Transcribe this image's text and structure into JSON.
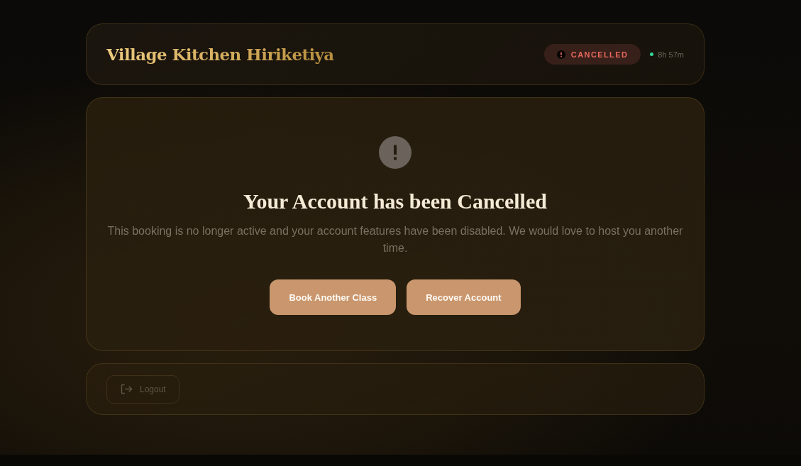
{
  "header": {
    "title": "Village Kitchen Hiriketiya",
    "status": {
      "kind": "cancelled",
      "label": "CANCELLED"
    },
    "timer": {
      "active": true,
      "text": "8h 57m"
    }
  },
  "notice": {
    "heading": "Your Account has been Cancelled",
    "message": "This booking is no longer active and your account features have been disabled. We would love to host you another time."
  },
  "actions": [
    {
      "label": "Book Another Class"
    },
    {
      "label": "Recover Account"
    }
  ],
  "footer": {
    "logout": {
      "label": "Logout"
    }
  }
}
